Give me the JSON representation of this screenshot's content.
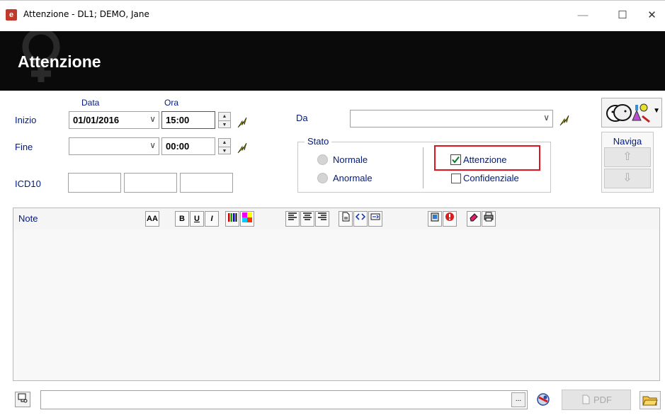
{
  "window": {
    "title": "Attenzione - DL1; DEMO,  Jane",
    "app_icon": "e",
    "min_glyph": "—",
    "max_glyph": "☐",
    "close_glyph": "✕"
  },
  "header": {
    "title": "Attenzione",
    "symbol_icon": "female-symbol-icon"
  },
  "form": {
    "col_data": "Data",
    "col_ora": "Ora",
    "inizio_label": "Inizio",
    "inizio_date": "01/01/2016",
    "inizio_time": "15:00",
    "fine_label": "Fine",
    "fine_date": "",
    "fine_time": "00:00",
    "icd10_label": "ICD10",
    "da_label": "Da",
    "da_value": ""
  },
  "stato": {
    "label": "Stato",
    "normale": "Normale",
    "anormale": "Anormale",
    "attenzione": "Attenzione",
    "attenzione_checked": true,
    "confidenziale": "Confidenziale",
    "confidenziale_checked": false,
    "highlight_color": "#e0141e"
  },
  "navigation": {
    "label": "Naviga",
    "up": "⇧",
    "down": "⇩"
  },
  "note": {
    "label": "Note",
    "content": ""
  },
  "toolbar": {
    "font_size": "AA",
    "bold": "B",
    "underline": "U",
    "italic": "I"
  },
  "footer": {
    "path_value": "",
    "ellipsis": "...",
    "pdf_label": "PDF"
  },
  "colors": {
    "label_blue": "#001a80",
    "header_bg": "#0a0a0a",
    "bolt_yellow": "#f4e400"
  }
}
